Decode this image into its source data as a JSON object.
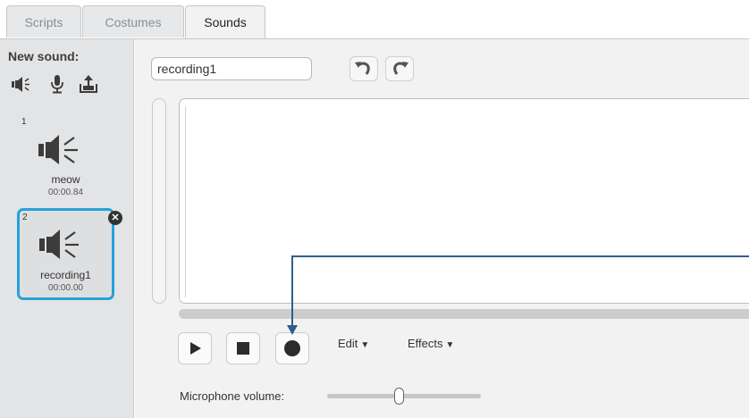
{
  "tabs": [
    {
      "label": "Scripts"
    },
    {
      "label": "Costumes"
    },
    {
      "label": "Sounds"
    }
  ],
  "left_panel": {
    "new_sound_label": "New sound:",
    "tools": [
      "speaker-library-icon",
      "microphone-icon",
      "upload-icon"
    ],
    "sounds": [
      {
        "number": "1",
        "name": "meow",
        "duration": "00:00.84"
      },
      {
        "number": "2",
        "name": "recording1",
        "duration": "00:00.00",
        "selected": true
      }
    ],
    "delete_glyph": "✕"
  },
  "editor": {
    "sound_name_value": "recording1",
    "undo_icon": "undo-icon",
    "redo_icon": "redo-icon",
    "controls": [
      "play-icon",
      "stop-icon",
      "record-icon"
    ],
    "menus": [
      {
        "label": "Edit",
        "arrow": "▼"
      },
      {
        "label": "Effects",
        "arrow": "▼"
      }
    ],
    "microphone_volume_label": "Microphone volume:",
    "microphone_volume_level": 0.47
  },
  "colors": {
    "selected_border": "#25a2d9",
    "callout_line": "#2e5f8c",
    "icon_dark": "#3c3c3c"
  }
}
